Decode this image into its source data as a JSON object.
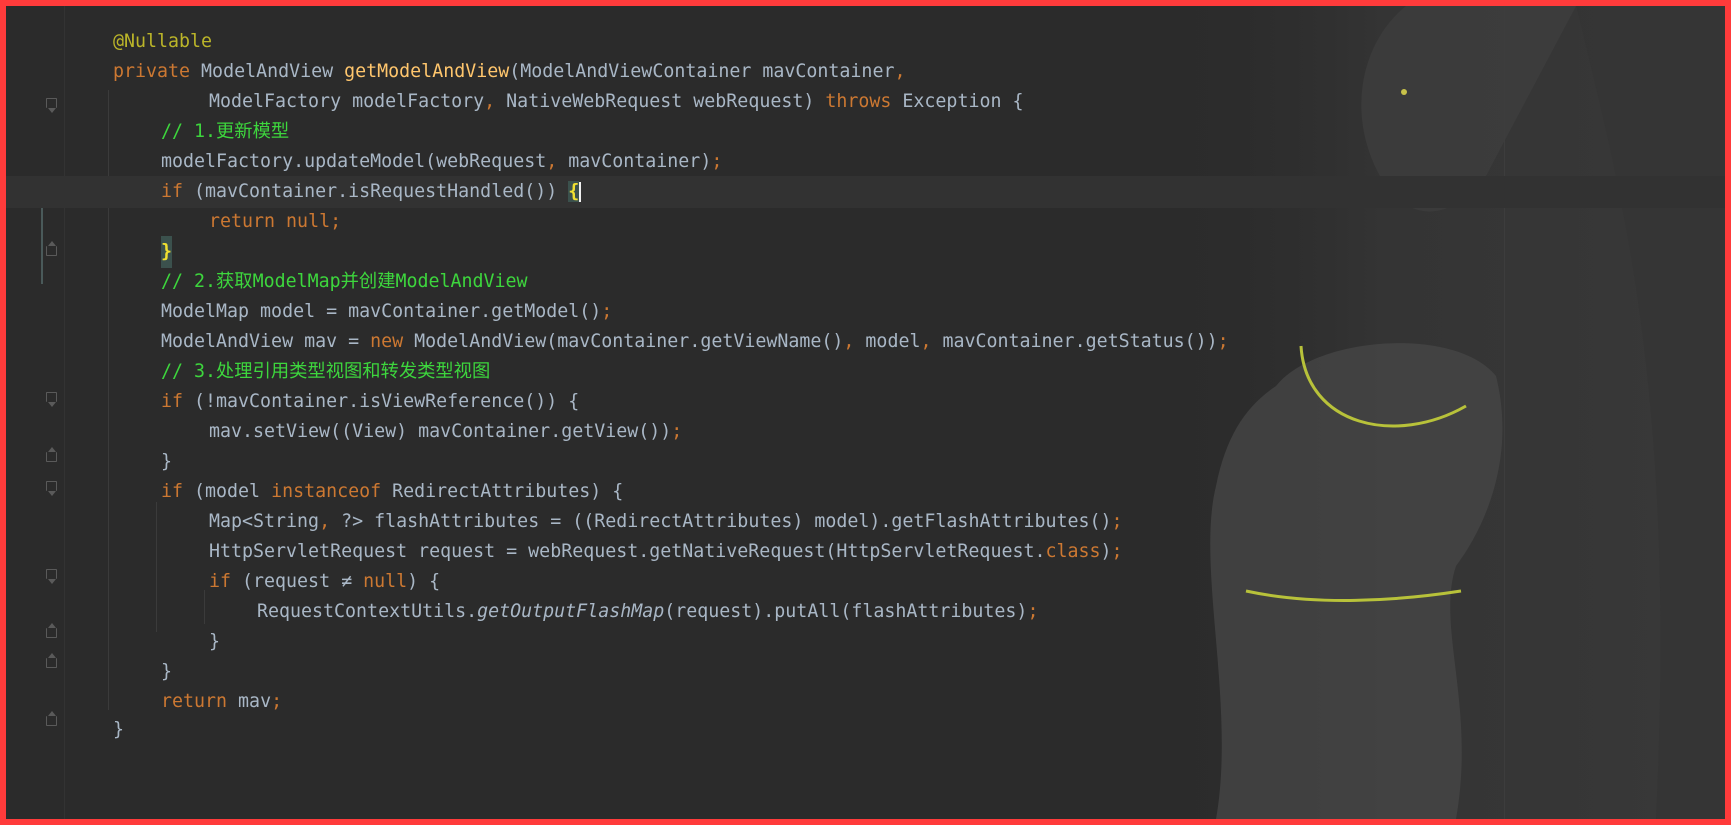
{
  "editor": {
    "language": "java",
    "theme_colors": {
      "background": "#2b2b2b",
      "keyword": "#cc7832",
      "annotation": "#bbb529",
      "method_decl": "#ffc66d",
      "comment": "#3dd63d",
      "text": "#a9b7c6",
      "frame": "#ff3b3b"
    },
    "lines": [
      {
        "p1": "@Nullable"
      },
      {
        "p1": "private",
        "p2": " ModelAndView ",
        "p3": "getModelAndView",
        "p4": "(ModelAndViewContainer mavContainer",
        ",": ",",
        "p5": ""
      },
      {
        "p1": "ModelFactory modelFactory",
        ",": ",",
        "p2": " NativeWebRequest webRequest) ",
        "p3": "throws",
        "p4": " Exception {"
      },
      {
        "p1": "// 1.更新模型"
      },
      {
        "p1": "modelFactory.updateModel(webRequest",
        ",": ",",
        "p2": " mavContainer)",
        ";": ";"
      },
      {
        "p1": "if",
        "p2": " (mavContainer.isRequestHandled()) ",
        "p3": "{"
      },
      {
        "p1": "return",
        "p2": " null",
        ";": ";"
      },
      {
        "p1": "}"
      },
      {
        "p1": "// 2.获取ModelMap并创建ModelAndView"
      },
      {
        "p1": "ModelMap model = mavContainer.getModel()",
        ";": ";"
      },
      {
        "p1": "ModelAndView mav = ",
        "p2": "new",
        "p3": " ModelAndView(mavContainer.getViewName()",
        ",": ",",
        "p4": " model",
        ",2": ",",
        "p5": " mavContainer.getStatus())",
        ";": ";"
      },
      {
        "p1": "// 3.处理引用类型视图和转发类型视图"
      },
      {
        "p1": "if",
        "p2": " (!mavContainer.isViewReference()) {"
      },
      {
        "p1": "mav.setView((View) mavContainer.getView())",
        ";": ";"
      },
      {
        "p1": "}"
      },
      {
        "p1": "if",
        "p2": " (model ",
        "p3": "instanceof",
        "p4": " RedirectAttributes) {"
      },
      {
        "p1": "Map<String",
        ",": ",",
        "p2": " ?> flashAttributes = ((RedirectAttributes) model).getFlashAttributes()",
        ";": ";"
      },
      {
        "p1": "HttpServletRequest request = webRequest.getNativeRequest(HttpServletRequest.",
        "p2": "class",
        "p3": ")",
        ";": ";"
      },
      {
        "p1": "if",
        "p2": " (request ≠ ",
        "p3": "null",
        "p4": ") {"
      },
      {
        "p1": "RequestContextUtils.",
        "p2": "getOutputFlashMap",
        "p3": "(request).putAll(flashAttributes)",
        ";": ";"
      },
      {
        "p1": "}"
      },
      {
        "p1": "}"
      },
      {
        "p1": "return",
        "p2": " mav",
        ";": ";"
      },
      {
        "p1": "}"
      }
    ]
  }
}
